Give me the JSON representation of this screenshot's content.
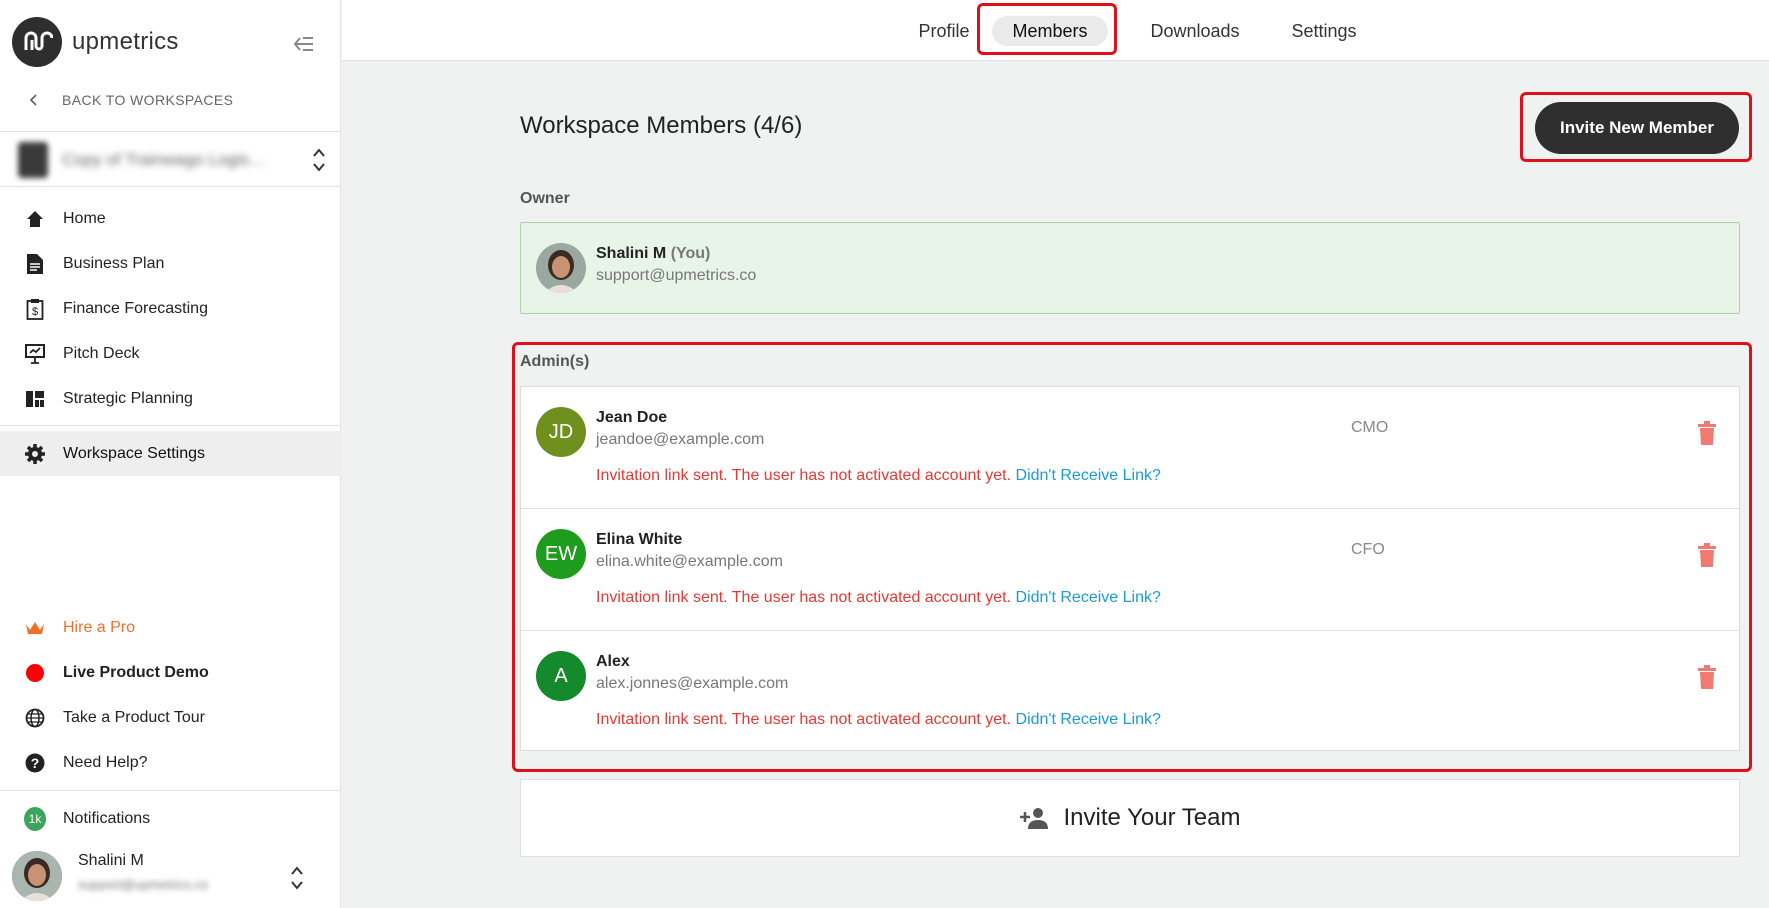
{
  "brand": {
    "name": "upmetrics"
  },
  "sidebar": {
    "back_label": "BACK TO WORKSPACES",
    "workspace_name": "Copy of Trainwago Logis…",
    "items": [
      {
        "label": "Home",
        "icon": "home-icon"
      },
      {
        "label": "Business Plan",
        "icon": "document-icon"
      },
      {
        "label": "Finance Forecasting",
        "icon": "finance-clipboard-icon"
      },
      {
        "label": "Pitch Deck",
        "icon": "presentation-icon"
      },
      {
        "label": "Strategic Planning",
        "icon": "dashboard-icon"
      },
      {
        "label": "Workspace Settings",
        "icon": "gear-icon",
        "active": true
      }
    ],
    "bottom": [
      {
        "label": "Hire a Pro",
        "icon": "crown-icon"
      },
      {
        "label": "Live Product Demo",
        "icon": "live-dot-icon"
      },
      {
        "label": "Take a Product Tour",
        "icon": "globe-icon"
      },
      {
        "label": "Need Help?",
        "icon": "help-icon"
      }
    ],
    "notifications": {
      "label": "Notifications",
      "badge": "1k"
    },
    "user": {
      "name": "Shalini M",
      "email": "support@upmetrics.co"
    }
  },
  "tabs": [
    {
      "label": "Profile"
    },
    {
      "label": "Members",
      "selected": true
    },
    {
      "label": "Downloads"
    },
    {
      "label": "Settings"
    }
  ],
  "main": {
    "title": "Workspace Members (4/6)",
    "invite_button": "Invite New Member",
    "owner_label": "Owner",
    "owner": {
      "name": "Shalini M",
      "you": "(You)",
      "email": "support@upmetrics.co"
    },
    "admins_label": "Admin(s)",
    "admins": [
      {
        "initials": "JD",
        "name": "Jean Doe",
        "email": "jeandoe@example.com",
        "role": "CMO",
        "color": "#6f8f1e"
      },
      {
        "initials": "EW",
        "name": "Elina White",
        "email": "elina.white@example.com",
        "role": "CFO",
        "color": "#1e9c1e"
      },
      {
        "initials": "A",
        "name": "Alex",
        "email": "alex.jonnes@example.com",
        "role": "",
        "color": "#148a2c"
      }
    ],
    "status_text": "Invitation link sent. The user has not activated account yet.",
    "resend_link": "Didn't Receive Link?",
    "invite_team": "Invite Your Team"
  },
  "colors": {
    "accent_red": "#e0101a",
    "error": "#e53935",
    "link": "#1a9bd7",
    "hire": "#f06f28"
  }
}
